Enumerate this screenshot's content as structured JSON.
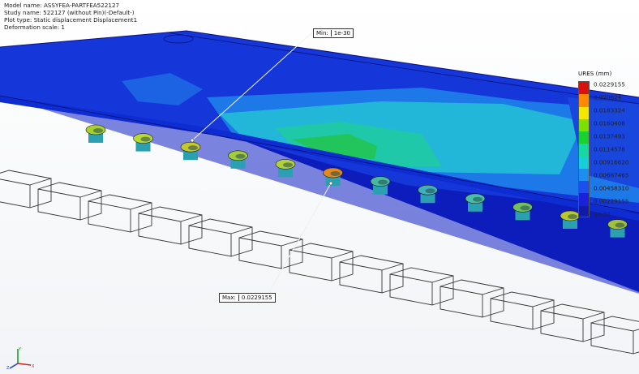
{
  "info": {
    "model_name": "Model name: ASSYFEA-PARTFEA522127",
    "study_name": "Study name: 522127 (without Pin)(-Default-)",
    "plot_type": "Plot type: Static displacement Displacement1",
    "deformation_scale": "Deformation scale: 1"
  },
  "legend": {
    "title": "URES (mm)",
    "ticks": [
      "0.0229155",
      "0.020624",
      "0.0183324",
      "0.0160408",
      "0.0137493",
      "0.0114578",
      "0.00916620",
      "0.00687465",
      "0.00458310",
      "0.00229155",
      "1e-30"
    ],
    "colors": [
      "#d8110c",
      "#ff8a00",
      "#f3e600",
      "#7ee000",
      "#18d230",
      "#18d8a0",
      "#18cfd8",
      "#1d8ef0",
      "#1a4ff0",
      "#1922d8",
      "#121aa8"
    ]
  },
  "probes": {
    "min_label": "Min:",
    "min_value": "1e-30",
    "max_label": "Max:",
    "max_value": "0.0229155"
  },
  "triad": {
    "x_label": "X",
    "y_label": "Y",
    "z_label": "Z"
  }
}
